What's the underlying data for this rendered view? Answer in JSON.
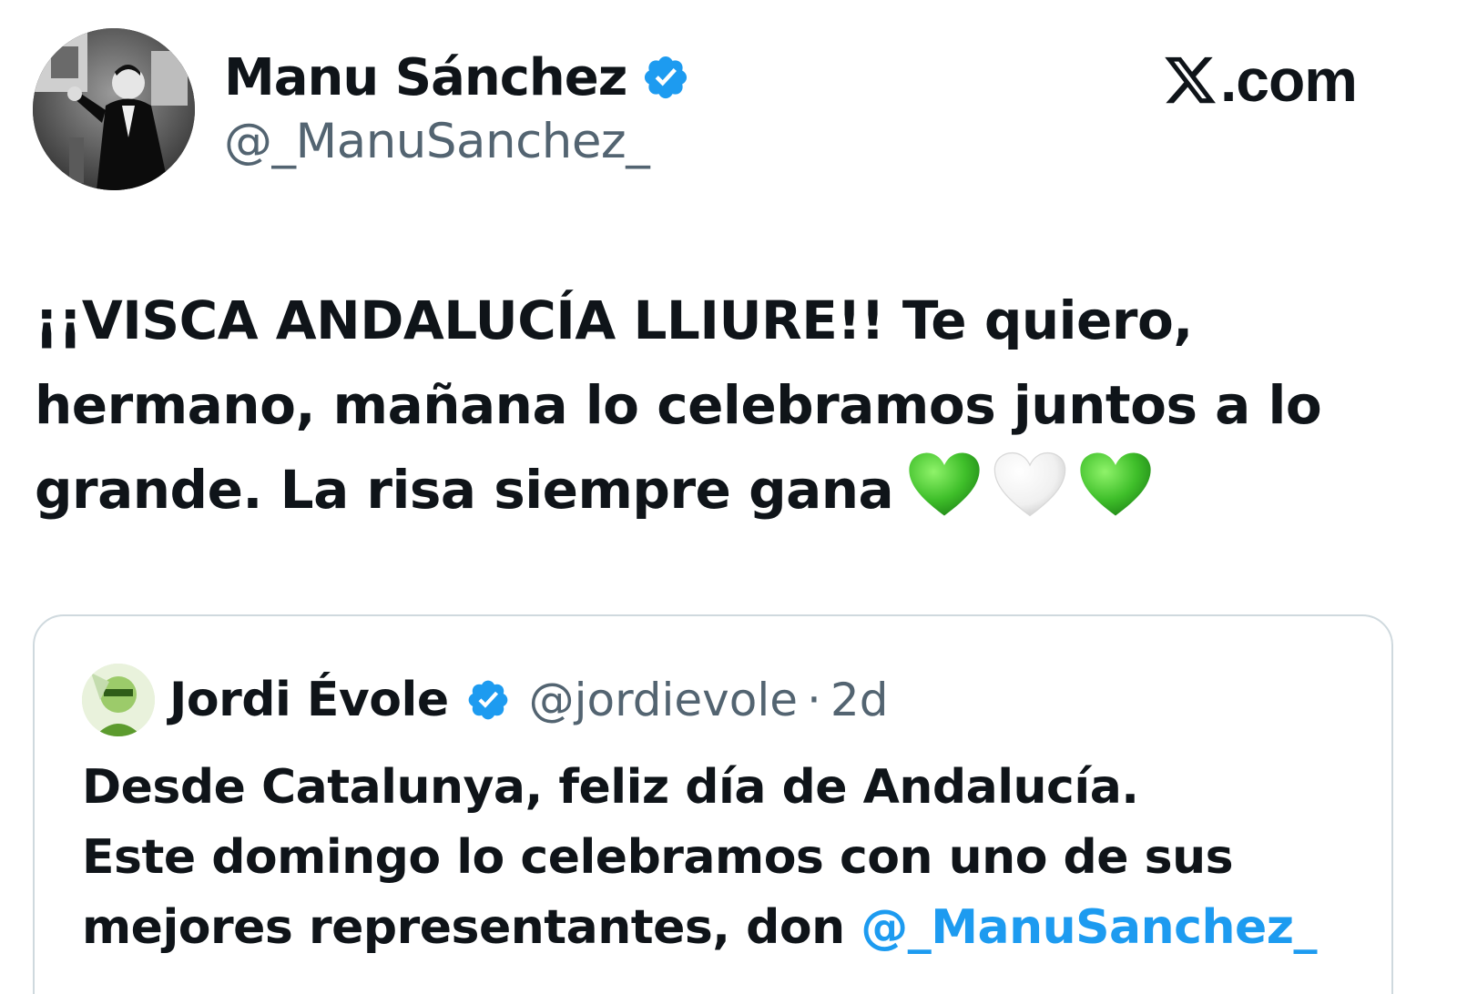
{
  "tweet": {
    "author": {
      "name": "Manu Sánchez",
      "handle": "@_ManuSanchez_",
      "verified": true
    },
    "source_label": ".com",
    "source_logo": "x-logo",
    "text": "¡¡VISCA ANDALUCÍA LLIURE!! Te quiero, hermano, mañana lo celebramos juntos a lo grande. La risa siempre gana",
    "emojis": [
      "green-heart",
      "white-heart",
      "green-heart"
    ]
  },
  "quoted_tweet": {
    "author": {
      "name": "Jordi Évole",
      "handle": "@jordievole",
      "verified": true
    },
    "separator": "·",
    "time": "2d",
    "line1": "Desde Catalunya, feliz día de Andalucía.",
    "line2": "Este domingo lo celebramos con uno de sus",
    "line3_prefix": "mejores representantes, don ",
    "mention": "@_ManuSanchez_"
  },
  "colors": {
    "text_primary": "#0f1419",
    "text_secondary": "#536471",
    "verified_blue": "#1d9bf0",
    "mention_blue": "#1d9bf0",
    "border": "#cfd9de",
    "heart_green": "#3fbf2a",
    "heart_white": "#f2f2f2"
  }
}
